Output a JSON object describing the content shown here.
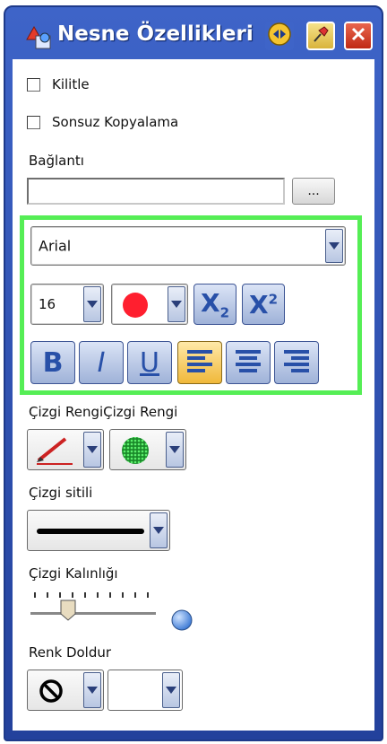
{
  "window": {
    "title": "Nesne Özellikleri"
  },
  "options": {
    "lock_label": "Kilitle",
    "infinite_copy_label": "Sonsuz Kopyalama"
  },
  "link": {
    "label": "Bağlantı",
    "value": "",
    "browse_label": "..."
  },
  "text_format": {
    "font": "Arial",
    "size": "16",
    "text_color": "#ff1f2f",
    "subscript_glyph": "X",
    "subscript_index": "2",
    "superscript_glyph": "X",
    "superscript_index": "2",
    "bold_glyph": "B",
    "italic_glyph": "I",
    "underline_glyph": "U",
    "alignment": "left"
  },
  "line_color": {
    "label": "Çizgi RengiÇizgi Rengi",
    "pen_color": "#cc2222",
    "fill_color": "#22cc44"
  },
  "line_style": {
    "label": "Çizgi sitili"
  },
  "line_width": {
    "label": "Çizgi Kalınlığı",
    "level": 0.3
  },
  "fill": {
    "label": "Renk Doldur"
  },
  "colors": {
    "title_bar": "#2f52b4",
    "highlight": "#55ee55",
    "accent_button": "#3d5594"
  }
}
